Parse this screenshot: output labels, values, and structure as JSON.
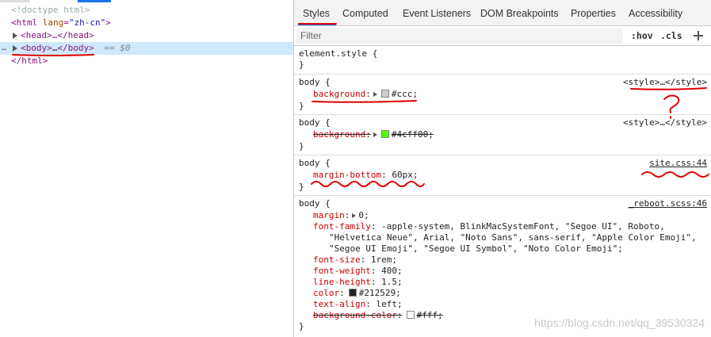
{
  "elements_panel": {
    "dom_lines": [
      {
        "kind": "doctype",
        "text": "<!doctype html>"
      },
      {
        "kind": "html_open",
        "tag_open": "<html",
        "attr": "lang",
        "eq": "=",
        "val": "\"zh-cn\"",
        "tag_close": ">"
      },
      {
        "kind": "head",
        "text": "<head>…</head>"
      },
      {
        "kind": "body",
        "open": "<body>",
        "dots": "…",
        "close": "</body>",
        "suffix": "== $0",
        "gutter": "…"
      },
      {
        "kind": "html_close",
        "text": "</html>"
      }
    ]
  },
  "styles_panel": {
    "tabs": [
      "Styles",
      "Computed",
      "Event Listeners",
      "DOM Breakpoints",
      "Properties",
      "Accessibility"
    ],
    "active_tab": "Styles",
    "filter": {
      "placeholder": "Filter",
      "value": ""
    },
    "hov_label": ":hov",
    "cls_label": ".cls",
    "rules": [
      {
        "selector": "element.style {",
        "close": "}",
        "source": "",
        "declarations": []
      },
      {
        "selector": "body {",
        "close": "}",
        "source": "<style>…</style>",
        "declarations": [
          {
            "prop": "background",
            "sep": ":",
            "value": "#ccc",
            "end": ";",
            "swatch": "#cccccc",
            "expander": true,
            "struck": false
          }
        ]
      },
      {
        "selector": "body {",
        "close": "}",
        "source": "<style>…</style>",
        "declarations": [
          {
            "prop": "background",
            "sep": ":",
            "value": "#4cff00",
            "end": ";",
            "swatch": "#4cff00",
            "expander": true,
            "struck": true
          }
        ]
      },
      {
        "selector": "body {",
        "close": "}",
        "source": "site.css:44",
        "declarations": [
          {
            "prop": "margin-bottom",
            "sep": ":",
            "value": " 60px",
            "end": ";",
            "struck": false
          }
        ]
      },
      {
        "selector": "body {",
        "close": "}",
        "source": "_reboot.scss:46",
        "declarations": [
          {
            "prop": "margin",
            "sep": ":",
            "value": "0",
            "end": ";",
            "expander": true,
            "struck": false
          },
          {
            "prop": "font-family",
            "sep": ":",
            "value": " -apple-system, BlinkMacSystemFont, \"Segoe UI\", Roboto,",
            "end": "",
            "struck": false
          },
          {
            "cont": "\"Helvetica Neue\", Arial, \"Noto Sans\", sans-serif, \"Apple Color Emoji\","
          },
          {
            "cont": "\"Segoe UI Emoji\", \"Segoe UI Symbol\", \"Noto Color Emoji\";"
          },
          {
            "prop": "font-size",
            "sep": ":",
            "value": " 1rem",
            "end": ";",
            "struck": false
          },
          {
            "prop": "font-weight",
            "sep": ":",
            "value": " 400",
            "end": ";",
            "struck": false
          },
          {
            "prop": "line-height",
            "sep": ":",
            "value": " 1.5",
            "end": ";",
            "struck": false
          },
          {
            "prop": "color",
            "sep": ":",
            "value": "#212529",
            "end": ";",
            "swatch": "#212529",
            "struck": false
          },
          {
            "prop": "text-align",
            "sep": ":",
            "value": " left",
            "end": ";",
            "struck": false
          },
          {
            "prop": "background-color",
            "sep": ":",
            "value": "#fff",
            "end": ";",
            "swatch": "#ffffff",
            "struck": true
          }
        ]
      }
    ]
  },
  "watermark": "https://blog.csdn.net/qq_39530324",
  "colors": {
    "accent": "#1a73e8",
    "annotation_red": "#e00000",
    "selected_row": "#cfe8fc",
    "property": "#c80000"
  }
}
